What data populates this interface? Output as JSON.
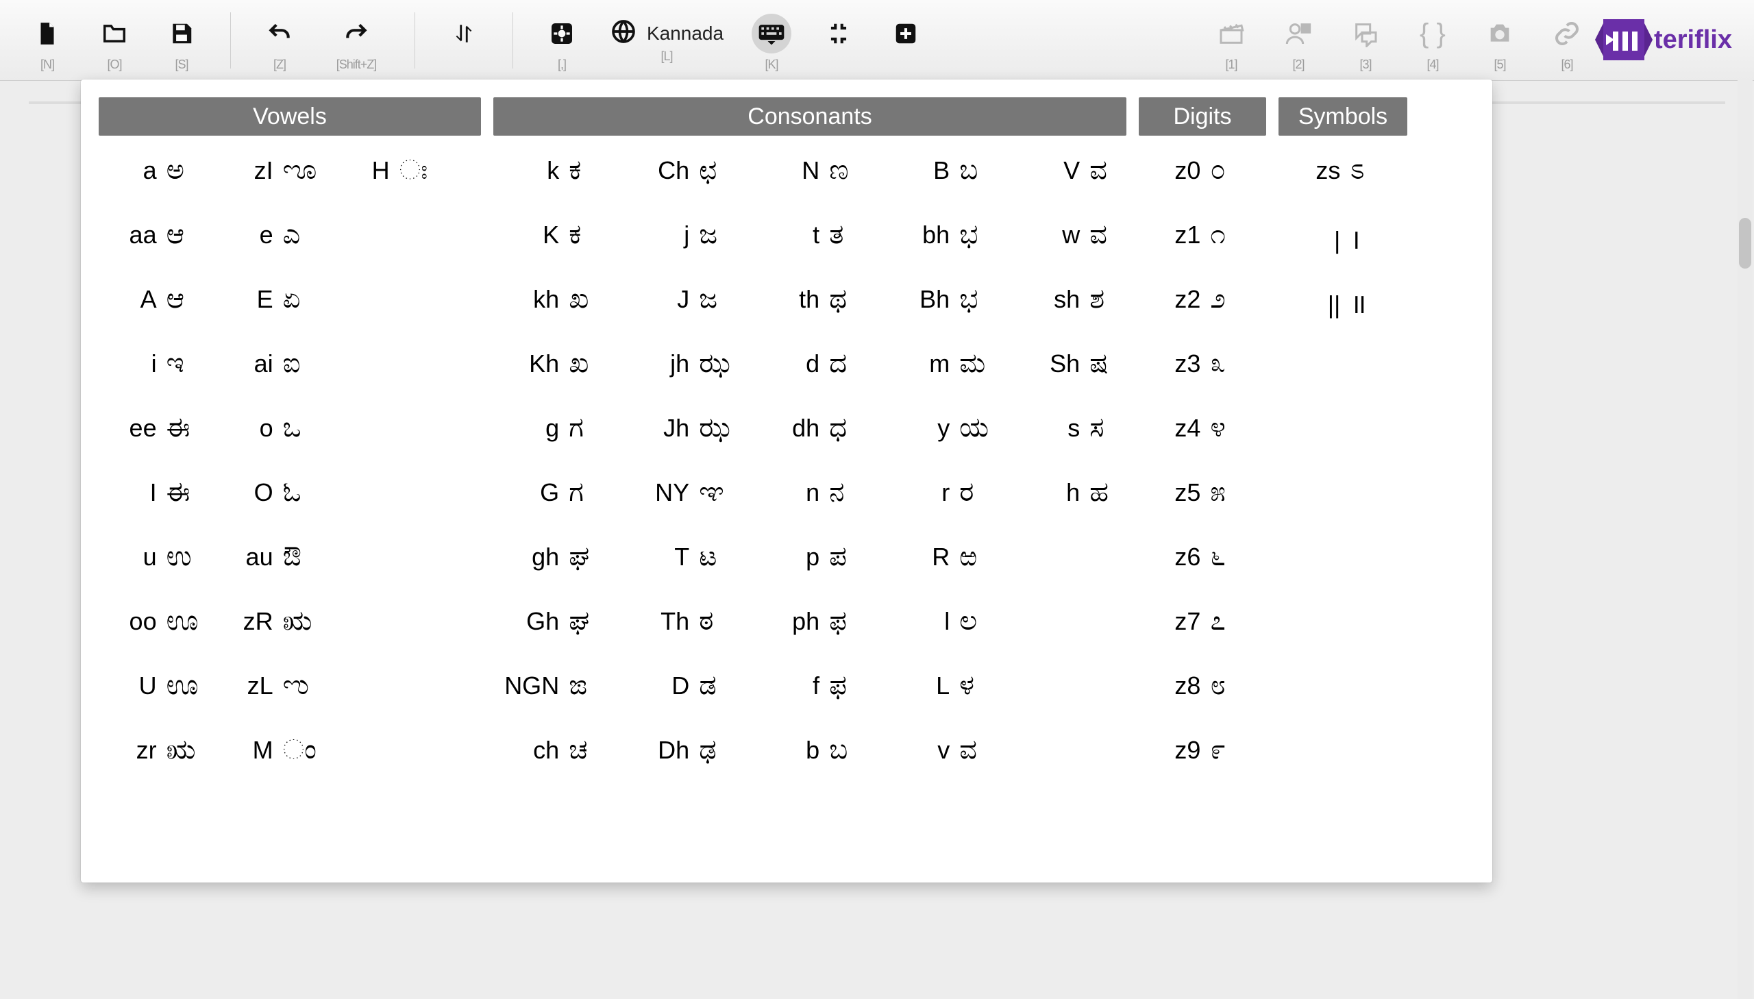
{
  "toolbar": {
    "new": {
      "shortcut": "[N]"
    },
    "open": {
      "shortcut": "[O]"
    },
    "save": {
      "shortcut": "[S]"
    },
    "undo": {
      "shortcut": "[Z]"
    },
    "redo": {
      "shortcut": "[Shift+Z]"
    },
    "sort": {
      "shortcut": ""
    },
    "settings": {
      "shortcut": "[,]"
    },
    "lang": {
      "label": "Kannada",
      "shortcut": "[L]"
    },
    "keyboard": {
      "shortcut": "[K]"
    },
    "collapse": {
      "shortcut": ""
    },
    "add": {
      "shortcut": ""
    },
    "scenes": {
      "shortcut": "[1]"
    },
    "cast": {
      "shortcut": "[2]"
    },
    "dialog": {
      "shortcut": "[3]"
    },
    "braces": {
      "shortcut": "[4]"
    },
    "camera": {
      "shortcut": "[5]"
    },
    "link": {
      "shortcut": "[6]"
    }
  },
  "brand": "teriflix",
  "headers": {
    "vowels": "Vowels",
    "consonants": "Consonants",
    "digits": "Digits",
    "symbols": "Symbols"
  },
  "vowels": [
    [
      {
        "l": "a",
        "s": "ಅ"
      },
      {
        "l": "zI",
        "s": "ೡ"
      },
      {
        "l": "H",
        "s": "ಃ"
      }
    ],
    [
      {
        "l": "aa",
        "s": "ಆ"
      },
      {
        "l": "e",
        "s": "ಎ"
      }
    ],
    [
      {
        "l": "A",
        "s": "ಆ"
      },
      {
        "l": "E",
        "s": "ಏ"
      }
    ],
    [
      {
        "l": "i",
        "s": "ಇ"
      },
      {
        "l": "ai",
        "s": "ಐ"
      }
    ],
    [
      {
        "l": "ee",
        "s": "ಈ"
      },
      {
        "l": "o",
        "s": "ಒ"
      }
    ],
    [
      {
        "l": "I",
        "s": "ಈ"
      },
      {
        "l": "O",
        "s": "ಓ"
      }
    ],
    [
      {
        "l": "u",
        "s": "ಉ"
      },
      {
        "l": "au",
        "s": "ಔ"
      }
    ],
    [
      {
        "l": "oo",
        "s": "ಊ"
      },
      {
        "l": "zR",
        "s": "ಋ"
      }
    ],
    [
      {
        "l": "U",
        "s": "ಊ"
      },
      {
        "l": "zL",
        "s": "ಌ"
      }
    ],
    [
      {
        "l": "zr",
        "s": "ಋ"
      },
      {
        "l": "M",
        "s": "ಂ"
      }
    ]
  ],
  "consonants": [
    [
      {
        "l": "k",
        "s": "ಕ"
      },
      {
        "l": "Ch",
        "s": "ಛ"
      },
      {
        "l": "N",
        "s": "ಣ"
      },
      {
        "l": "B",
        "s": "ಬ"
      },
      {
        "l": "V",
        "s": "ವ"
      }
    ],
    [
      {
        "l": "K",
        "s": "ಕ"
      },
      {
        "l": "j",
        "s": "ಜ"
      },
      {
        "l": "t",
        "s": "ತ"
      },
      {
        "l": "bh",
        "s": "ಭ"
      },
      {
        "l": "w",
        "s": "ವ"
      }
    ],
    [
      {
        "l": "kh",
        "s": "ಖ"
      },
      {
        "l": "J",
        "s": "ಜ"
      },
      {
        "l": "th",
        "s": "ಥ"
      },
      {
        "l": "Bh",
        "s": "ಭ"
      },
      {
        "l": "sh",
        "s": "ಶ"
      }
    ],
    [
      {
        "l": "Kh",
        "s": "ಖ"
      },
      {
        "l": "jh",
        "s": "ಝ"
      },
      {
        "l": "d",
        "s": "ದ"
      },
      {
        "l": "m",
        "s": "ಮ"
      },
      {
        "l": "Sh",
        "s": "ಷ"
      }
    ],
    [
      {
        "l": "g",
        "s": "ಗ"
      },
      {
        "l": "Jh",
        "s": "ಝ"
      },
      {
        "l": "dh",
        "s": "ಧ"
      },
      {
        "l": "y",
        "s": "ಯ"
      },
      {
        "l": "s",
        "s": "ಸ"
      }
    ],
    [
      {
        "l": "G",
        "s": "ಗ"
      },
      {
        "l": "NY",
        "s": "ಞ"
      },
      {
        "l": "n",
        "s": "ನ"
      },
      {
        "l": "r",
        "s": "ರ"
      },
      {
        "l": "h",
        "s": "ಹ"
      }
    ],
    [
      {
        "l": "gh",
        "s": "ಘ"
      },
      {
        "l": "T",
        "s": "ಟ"
      },
      {
        "l": "p",
        "s": "ಪ"
      },
      {
        "l": "R",
        "s": "ಱ"
      }
    ],
    [
      {
        "l": "Gh",
        "s": "ಘ"
      },
      {
        "l": "Th",
        "s": "ಠ"
      },
      {
        "l": "ph",
        "s": "ಫ"
      },
      {
        "l": "l",
        "s": "ಲ"
      }
    ],
    [
      {
        "l": "NGN",
        "s": "ಙ"
      },
      {
        "l": "D",
        "s": "ಡ"
      },
      {
        "l": "f",
        "s": "ಫ"
      },
      {
        "l": "L",
        "s": "ಳ"
      }
    ],
    [
      {
        "l": "ch",
        "s": "ಚ"
      },
      {
        "l": "Dh",
        "s": "ಢ"
      },
      {
        "l": "b",
        "s": "ಬ"
      },
      {
        "l": "v",
        "s": "ವ"
      }
    ]
  ],
  "digits": [
    {
      "l": "z0",
      "s": "೦"
    },
    {
      "l": "z1",
      "s": "೧"
    },
    {
      "l": "z2",
      "s": "೨"
    },
    {
      "l": "z3",
      "s": "೩"
    },
    {
      "l": "z4",
      "s": "೪"
    },
    {
      "l": "z5",
      "s": "೫"
    },
    {
      "l": "z6",
      "s": "೬"
    },
    {
      "l": "z7",
      "s": "೭"
    },
    {
      "l": "z8",
      "s": "೮"
    },
    {
      "l": "z9",
      "s": "೯"
    }
  ],
  "symbols": [
    {
      "l": "zs",
      "s": "ಽ"
    },
    {
      "l": "|",
      "s": "।"
    },
    {
      "l": "||",
      "s": "॥"
    }
  ]
}
